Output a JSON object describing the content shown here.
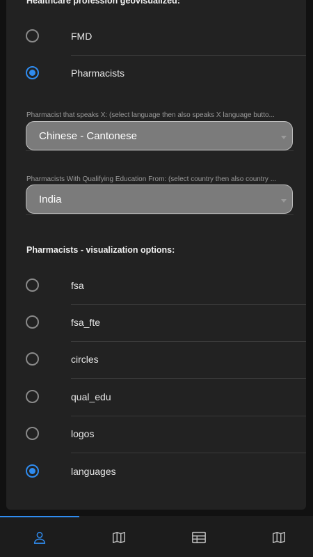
{
  "profession_section": {
    "title": "Healthcare profession geovisualized:",
    "options": [
      {
        "label": "FMD",
        "selected": false
      },
      {
        "label": "Pharmacists",
        "selected": true
      }
    ]
  },
  "language_field": {
    "label": "Pharmacist that speaks X: (select language then also speaks X language butto...",
    "value": "Chinese - Cantonese"
  },
  "education_field": {
    "label": "Pharmacists With Qualifying Education From: (select country then also country ...",
    "value": "India"
  },
  "visualization_section": {
    "title": "Pharmacists - visualization options:",
    "options": [
      {
        "label": "fsa",
        "selected": false
      },
      {
        "label": "fsa_fte",
        "selected": false
      },
      {
        "label": "circles",
        "selected": false
      },
      {
        "label": "qual_edu",
        "selected": false
      },
      {
        "label": "logos",
        "selected": false
      },
      {
        "label": "languages",
        "selected": true
      }
    ]
  },
  "bottom_nav": {
    "items": [
      {
        "icon": "person-icon",
        "active": true
      },
      {
        "icon": "map-icon",
        "active": false
      },
      {
        "icon": "table-icon",
        "active": false
      },
      {
        "icon": "map-icon",
        "active": false
      }
    ]
  },
  "colors": {
    "accent": "#2f8cf0",
    "panel": "#222222",
    "select_bg": "#7b7b7b"
  }
}
